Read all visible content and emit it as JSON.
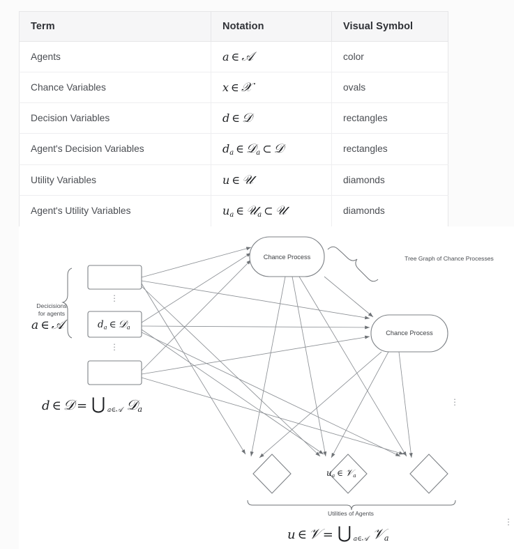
{
  "table": {
    "headers": [
      "Term",
      "Notation",
      "Visual Symbol"
    ],
    "rows": [
      {
        "term": "Agents",
        "notation_plain": "a ∈ A",
        "symbol": "color"
      },
      {
        "term": "Chance Variables",
        "notation_plain": "x ∈ X",
        "symbol": "ovals"
      },
      {
        "term": "Decision Variables",
        "notation_plain": "d ∈ D",
        "symbol": "rectangles"
      },
      {
        "term": "Agent's Decision Variables",
        "notation_plain": "d_a ∈ D_a ⊂ D",
        "symbol": "rectangles"
      },
      {
        "term": "Utility Variables",
        "notation_plain": "u ∈ U",
        "symbol": "diamonds"
      },
      {
        "term": "Agent's Utility Variables",
        "notation_plain": "u_a ∈ U_a ⊂ U",
        "symbol": "diamonds"
      }
    ]
  },
  "diagram": {
    "decision_group_label_line1": "Decicisions",
    "decision_group_label_line2": "for agents",
    "decision_group_set": "a ∈ A",
    "decision_middle_node": "d_a ∈ D_a",
    "decision_union_formula": "d ∈ D = ⋃_{a∈A} D_a",
    "chance_node_1": "Chance Process",
    "chance_node_2": "Chance Process",
    "tree_graph_label": "Tree Graph of Chance Processes",
    "utility_middle_node": "u_a ∈ U_a",
    "utilities_brace_label": "Utilities of Agents",
    "utility_union_formula": "u ∈ U = ⋃_{a∈A} U_a",
    "vertical_ellipsis": "⋮"
  },
  "colors": {
    "page_background": "#fbfbfb",
    "panel_background": "#ffffff",
    "table_header_background": "#f6f6f7",
    "table_border": "#e6e6e8",
    "text_primary": "#2f3136",
    "text_secondary": "#4a4d52",
    "stroke": "#6e7276"
  }
}
